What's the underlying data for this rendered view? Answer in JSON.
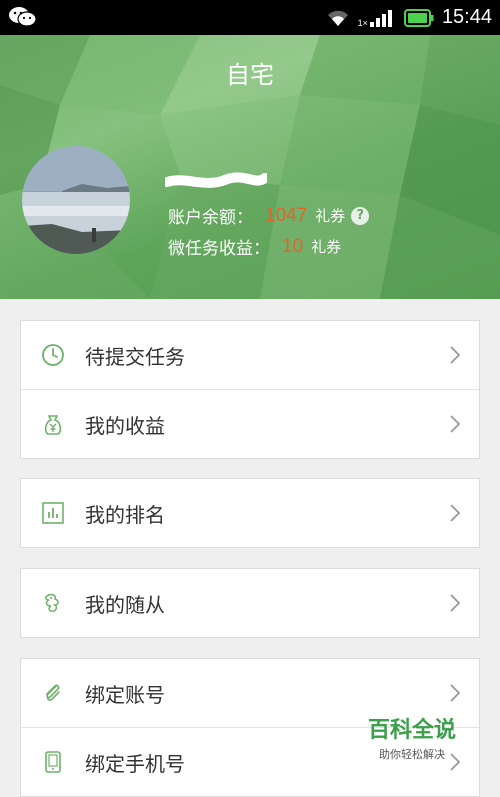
{
  "status_bar": {
    "time": "15:44",
    "network_label": "1×"
  },
  "header": {
    "title": "自宅",
    "balance_label": "账户余额：",
    "balance_value": "1047",
    "balance_unit": "礼券",
    "help_symbol": "?",
    "earnings_label": "微任务收益：",
    "earnings_value": "10",
    "earnings_unit": "礼券"
  },
  "menu": {
    "pending_tasks": "待提交任务",
    "my_earnings": "我的收益",
    "my_ranking": "我的排名",
    "my_followers": "我的随从",
    "bind_account": "绑定账号",
    "bind_phone": "绑定手机号"
  },
  "watermark": {
    "title": "百科全说",
    "subtitle": "助你轻松解决"
  },
  "colors": {
    "accent": "#6db36a",
    "number": "#e0652a",
    "header_green": "#6fb26a"
  }
}
